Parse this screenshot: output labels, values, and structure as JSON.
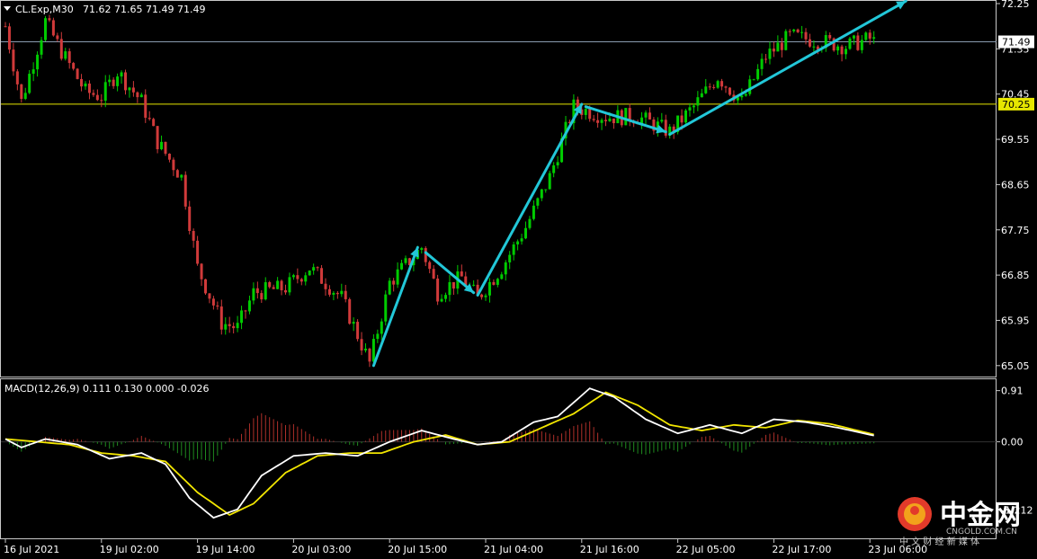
{
  "colors": {
    "background": "#000000",
    "frame": "#c8c8c8",
    "bull_candle": "#00cc00",
    "bear_candle": "#d03a3a",
    "ask_line": "#8a9bb0",
    "support_line": "#e6e600",
    "arrow": "#22c7d8",
    "macd_line": "#ffffff",
    "signal_line": "#f2e600",
    "hist_up": "#b0302a",
    "hist_down": "#1f8a1f"
  },
  "chart_data": [
    {
      "type": "candlestick",
      "symbol": "CL.Exp,M30",
      "ohlc_label": "71.62 71.65 71.49 71.49",
      "current_price": 71.49,
      "current_price_label": "71.49",
      "level_line": 70.25,
      "level_line_label": "70.25",
      "ylim": [
        64.85,
        72.25
      ],
      "y_ticks": [
        "72.25",
        "71.35",
        "70.45",
        "69.55",
        "68.65",
        "67.75",
        "66.85",
        "65.95",
        "65.05"
      ],
      "y_tick_values": [
        72.25,
        71.35,
        70.45,
        69.55,
        68.65,
        67.75,
        66.85,
        65.95,
        65.05
      ],
      "x_ticks": [
        "16 Jul 2021",
        "19 Jul 02:00",
        "19 Jul 14:00",
        "20 Jul 03:00",
        "20 Jul 15:00",
        "21 Jul 04:00",
        "21 Jul 16:00",
        "22 Jul 05:00",
        "22 Jul 17:00",
        "23 Jul 06:00"
      ],
      "x_tick_bars": [
        0,
        24,
        48,
        72,
        96,
        120,
        144,
        168,
        192,
        216
      ],
      "num_bars": 218,
      "close_path": [
        {
          "bar": 0,
          "price": 71.8
        },
        {
          "bar": 4,
          "price": 70.3
        },
        {
          "bar": 10,
          "price": 71.9
        },
        {
          "bar": 14,
          "price": 71.3
        },
        {
          "bar": 20,
          "price": 70.5
        },
        {
          "bar": 24,
          "price": 70.4
        },
        {
          "bar": 28,
          "price": 70.9
        },
        {
          "bar": 34,
          "price": 70.3
        },
        {
          "bar": 38,
          "price": 69.5
        },
        {
          "bar": 44,
          "price": 68.8
        },
        {
          "bar": 48,
          "price": 67.0
        },
        {
          "bar": 54,
          "price": 65.9
        },
        {
          "bar": 58,
          "price": 65.8
        },
        {
          "bar": 62,
          "price": 66.5
        },
        {
          "bar": 70,
          "price": 66.6
        },
        {
          "bar": 76,
          "price": 67.0
        },
        {
          "bar": 84,
          "price": 66.4
        },
        {
          "bar": 91,
          "price": 65.1
        },
        {
          "bar": 96,
          "price": 66.7
        },
        {
          "bar": 104,
          "price": 67.4
        },
        {
          "bar": 108,
          "price": 66.5
        },
        {
          "bar": 114,
          "price": 66.8
        },
        {
          "bar": 118,
          "price": 66.4
        },
        {
          "bar": 124,
          "price": 67.0
        },
        {
          "bar": 130,
          "price": 67.8
        },
        {
          "bar": 136,
          "price": 68.8
        },
        {
          "bar": 142,
          "price": 70.2
        },
        {
          "bar": 150,
          "price": 70.0
        },
        {
          "bar": 158,
          "price": 70.0
        },
        {
          "bar": 166,
          "price": 69.7
        },
        {
          "bar": 172,
          "price": 70.2
        },
        {
          "bar": 178,
          "price": 70.8
        },
        {
          "bar": 184,
          "price": 70.3
        },
        {
          "bar": 190,
          "price": 71.2
        },
        {
          "bar": 196,
          "price": 71.6
        },
        {
          "bar": 204,
          "price": 71.5
        },
        {
          "bar": 210,
          "price": 71.4
        },
        {
          "bar": 216,
          "price": 71.55
        },
        {
          "bar": 217,
          "price": 71.49
        }
      ],
      "arrows": [
        {
          "from": {
            "bar": 92,
            "price": 65.05
          },
          "to": {
            "bar": 103,
            "price": 67.4
          }
        },
        {
          "from": {
            "bar": 105,
            "price": 67.3
          },
          "to": {
            "bar": 117,
            "price": 66.5
          }
        },
        {
          "from": {
            "bar": 118,
            "price": 66.45
          },
          "to": {
            "bar": 144,
            "price": 70.25
          }
        },
        {
          "from": {
            "bar": 145,
            "price": 70.2
          },
          "to": {
            "bar": 165,
            "price": 69.7
          }
        },
        {
          "from": {
            "bar": 166,
            "price": 69.65
          },
          "to": {
            "bar": 225,
            "price": 72.3
          }
        }
      ]
    },
    {
      "type": "line",
      "label": "MACD(12,26,9) 0.111 0.130 0.000 -0.026",
      "ylim": [
        -1.7,
        1.08
      ],
      "y_ticks": [
        "0.91",
        "0.00",
        "-1.212"
      ],
      "y_tick_values": [
        0.91,
        0.0,
        -1.212
      ],
      "series": [
        {
          "name": "MACD",
          "points": [
            {
              "bar": 0,
              "value": 0.05
            },
            {
              "bar": 4,
              "value": -0.1
            },
            {
              "bar": 10,
              "value": 0.05
            },
            {
              "bar": 18,
              "value": -0.05
            },
            {
              "bar": 26,
              "value": -0.3
            },
            {
              "bar": 34,
              "value": -0.2
            },
            {
              "bar": 40,
              "value": -0.4
            },
            {
              "bar": 46,
              "value": -1.0
            },
            {
              "bar": 52,
              "value": -1.35
            },
            {
              "bar": 58,
              "value": -1.2
            },
            {
              "bar": 64,
              "value": -0.6
            },
            {
              "bar": 72,
              "value": -0.25
            },
            {
              "bar": 80,
              "value": -0.2
            },
            {
              "bar": 88,
              "value": -0.25
            },
            {
              "bar": 96,
              "value": 0.0
            },
            {
              "bar": 104,
              "value": 0.2
            },
            {
              "bar": 112,
              "value": 0.05
            },
            {
              "bar": 118,
              "value": -0.05
            },
            {
              "bar": 124,
              "value": 0.0
            },
            {
              "bar": 132,
              "value": 0.35
            },
            {
              "bar": 138,
              "value": 0.45
            },
            {
              "bar": 146,
              "value": 0.95
            },
            {
              "bar": 152,
              "value": 0.8
            },
            {
              "bar": 160,
              "value": 0.4
            },
            {
              "bar": 168,
              "value": 0.15
            },
            {
              "bar": 176,
              "value": 0.3
            },
            {
              "bar": 184,
              "value": 0.15
            },
            {
              "bar": 192,
              "value": 0.4
            },
            {
              "bar": 200,
              "value": 0.35
            },
            {
              "bar": 208,
              "value": 0.25
            },
            {
              "bar": 217,
              "value": 0.111
            }
          ]
        },
        {
          "name": "Signal",
          "points": [
            {
              "bar": 0,
              "value": 0.05
            },
            {
              "bar": 8,
              "value": 0.0
            },
            {
              "bar": 16,
              "value": -0.05
            },
            {
              "bar": 24,
              "value": -0.2
            },
            {
              "bar": 32,
              "value": -0.25
            },
            {
              "bar": 40,
              "value": -0.35
            },
            {
              "bar": 48,
              "value": -0.9
            },
            {
              "bar": 56,
              "value": -1.3
            },
            {
              "bar": 62,
              "value": -1.1
            },
            {
              "bar": 70,
              "value": -0.55
            },
            {
              "bar": 78,
              "value": -0.25
            },
            {
              "bar": 86,
              "value": -0.2
            },
            {
              "bar": 94,
              "value": -0.2
            },
            {
              "bar": 102,
              "value": 0.0
            },
            {
              "bar": 110,
              "value": 0.12
            },
            {
              "bar": 118,
              "value": -0.05
            },
            {
              "bar": 126,
              "value": 0.0
            },
            {
              "bar": 134,
              "value": 0.25
            },
            {
              "bar": 142,
              "value": 0.5
            },
            {
              "bar": 150,
              "value": 0.88
            },
            {
              "bar": 158,
              "value": 0.65
            },
            {
              "bar": 166,
              "value": 0.3
            },
            {
              "bar": 174,
              "value": 0.2
            },
            {
              "bar": 182,
              "value": 0.3
            },
            {
              "bar": 190,
              "value": 0.25
            },
            {
              "bar": 198,
              "value": 0.38
            },
            {
              "bar": 206,
              "value": 0.32
            },
            {
              "bar": 217,
              "value": 0.13
            }
          ]
        }
      ]
    }
  ],
  "watermark": {
    "brand": "中金网",
    "domain": "CNGOLD.COM.CN",
    "tagline": "中 文 财 经 新 媒 体"
  }
}
